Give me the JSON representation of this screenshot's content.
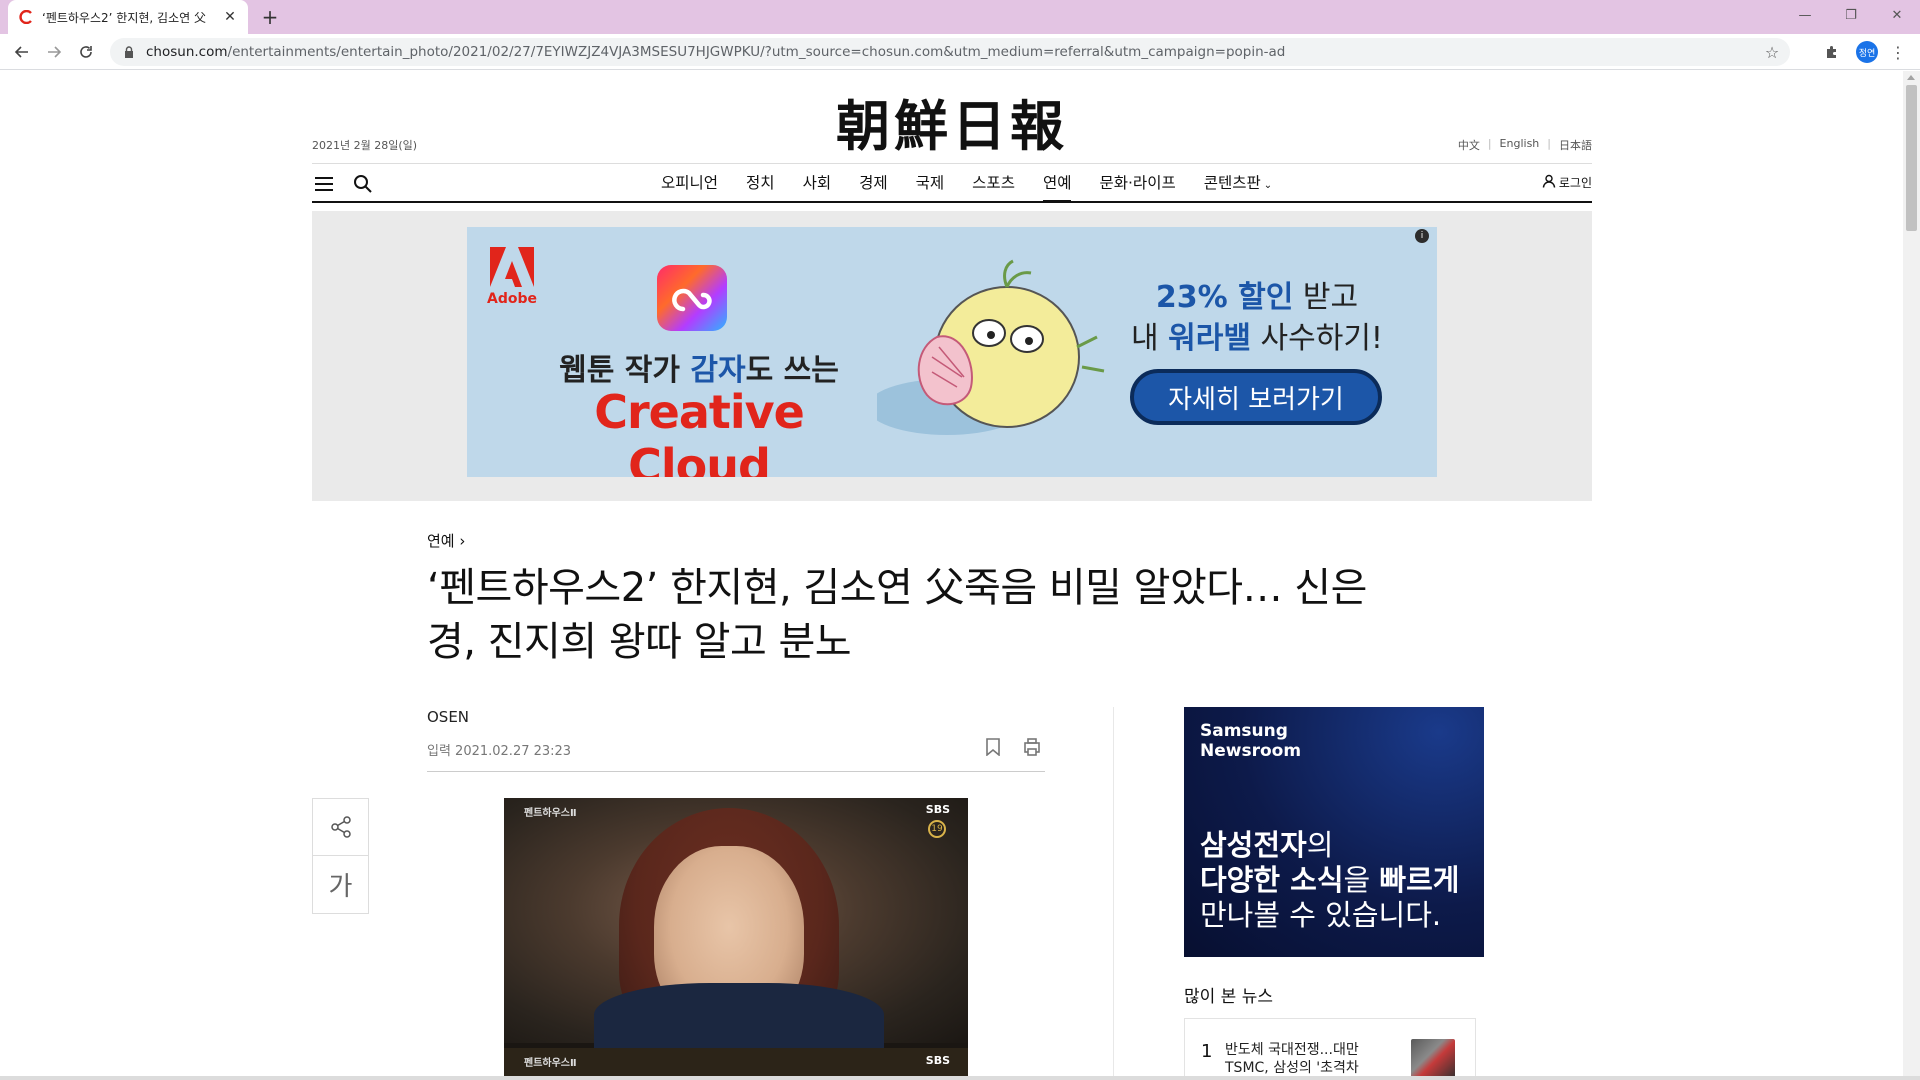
{
  "browser": {
    "tab_title": "‘펜트하우스2’ 한지현, 김소연 父",
    "url_host": "chosun.com",
    "url_path": "/entertainments/entertain_photo/2021/02/27/7EYIWZJZ4VJA3MSESU7HJGWPKU/?utm_source=chosun.com&utm_medium=referral&utm_campaign=popin-ad",
    "profile_initials": "정연"
  },
  "masthead": {
    "logo_text": "朝鮮日報",
    "date": "2021년 2월 28일(일)",
    "langs": [
      "中文",
      "English",
      "日本語"
    ]
  },
  "nav": {
    "items": [
      {
        "label": "오피니언",
        "active": false
      },
      {
        "label": "정치",
        "active": false
      },
      {
        "label": "사회",
        "active": false
      },
      {
        "label": "경제",
        "active": false
      },
      {
        "label": "국제",
        "active": false
      },
      {
        "label": "스포츠",
        "active": false
      },
      {
        "label": "연예",
        "active": true
      },
      {
        "label": "문화·라이프",
        "active": false
      },
      {
        "label": "콘텐츠판",
        "active": false
      }
    ],
    "login_label": "로그인"
  },
  "ad_top": {
    "brand": "Adobe",
    "line1_pre": "웹툰 작가 ",
    "line1_em": "감자",
    "line1_post": "도 쓰는",
    "line2": "Creative Cloud",
    "right1_em": "23% 할인",
    "right1_post": " 받고",
    "right2_pre": "내 ",
    "right2_em": "워라밸",
    "right2_post": " 사수하기!",
    "cta": "자세히 보러가기"
  },
  "article": {
    "section": "연예",
    "headline": "‘펜트하우스2’ 한지현, 김소연 父죽음 비밀 알았다… 신은경, 진지희 왕따 알고 분노",
    "byline": "OSEN",
    "timestamp": "입력 2021.02.27 23:23",
    "photo_tag": "펜트하우스Ⅱ",
    "photo_channel": "SBS",
    "photo_rating": "19",
    "font_tool_label": "가"
  },
  "side_ad": {
    "brand_line1": "Samsung",
    "brand_line2": "Newsroom",
    "l1_em": "삼성전자",
    "l1_post": "의",
    "l2_em1": "다양한 소식",
    "l2_mid": "을 ",
    "l2_em2": "빠르게",
    "l3": "만나볼 수 있습니다."
  },
  "popular": {
    "title": "많이 본 뉴스",
    "items": [
      {
        "rank": "1",
        "text": "반도체 국대전쟁...대만 TSMC, 삼성의 '초격차"
      }
    ]
  },
  "colors": {
    "tab_bar": "#e3c4e3",
    "adobe_red": "#e1251b",
    "ad_blue": "#1c56a8",
    "ad_bg": "#bfd8ea",
    "samsung_navy": "#0d1a4a"
  }
}
